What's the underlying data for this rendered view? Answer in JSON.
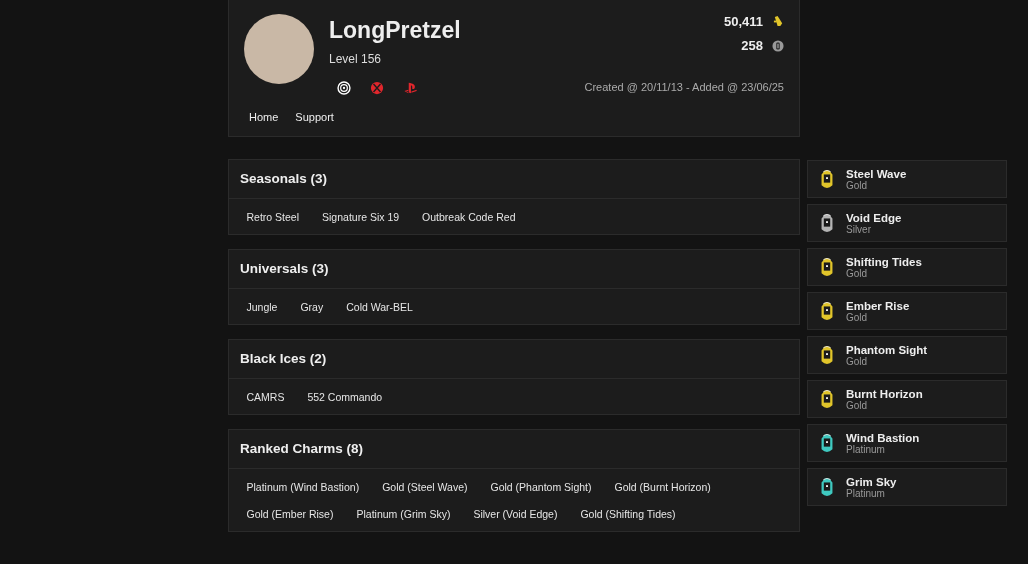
{
  "profile": {
    "name": "LongPretzel",
    "level": "Level 156",
    "platforms": [
      {
        "kind": "ubisoft"
      },
      {
        "kind": "xbox"
      },
      {
        "kind": "playstation"
      }
    ],
    "stats": [
      {
        "kind": "renown",
        "value": "50,411"
      },
      {
        "kind": "credits",
        "value": "258"
      }
    ],
    "dates": "Created @ 20/11/13 - Added @ 23/06/25",
    "nav": [
      "Home",
      "Support"
    ]
  },
  "sections": [
    {
      "title": "Seasonals (3)",
      "items": [
        "Retro Steel",
        "Signature Six 19",
        "Outbreak Code Red"
      ]
    },
    {
      "title": "Universals (3)",
      "items": [
        "Jungle",
        "Gray",
        "Cold War-BEL"
      ]
    },
    {
      "title": "Black Ices (2)",
      "items": [
        "CAMRS",
        "552 Commando"
      ]
    },
    {
      "title": "Ranked Charms (8)",
      "items": [
        "Platinum (Wind Bastion)",
        "Gold (Steel Wave)",
        "Gold (Phantom Sight)",
        "Gold (Burnt Horizon)",
        "Gold (Ember Rise)",
        "Platinum (Grim Sky)",
        "Silver (Void Edge)",
        "Gold (Shifting Tides)"
      ]
    }
  ],
  "charms": [
    {
      "name": "Steel Wave",
      "tier": "Gold",
      "color": "#e1c52a"
    },
    {
      "name": "Void Edge",
      "tier": "Silver",
      "color": "#b4b4b4"
    },
    {
      "name": "Shifting Tides",
      "tier": "Gold",
      "color": "#e1c52a"
    },
    {
      "name": "Ember Rise",
      "tier": "Gold",
      "color": "#e1c52a"
    },
    {
      "name": "Phantom Sight",
      "tier": "Gold",
      "color": "#e1c52a"
    },
    {
      "name": "Burnt Horizon",
      "tier": "Gold",
      "color": "#e1c52a"
    },
    {
      "name": "Wind Bastion",
      "tier": "Platinum",
      "color": "#3fc9c0"
    },
    {
      "name": "Grim Sky",
      "tier": "Platinum",
      "color": "#3fc9c0"
    }
  ]
}
